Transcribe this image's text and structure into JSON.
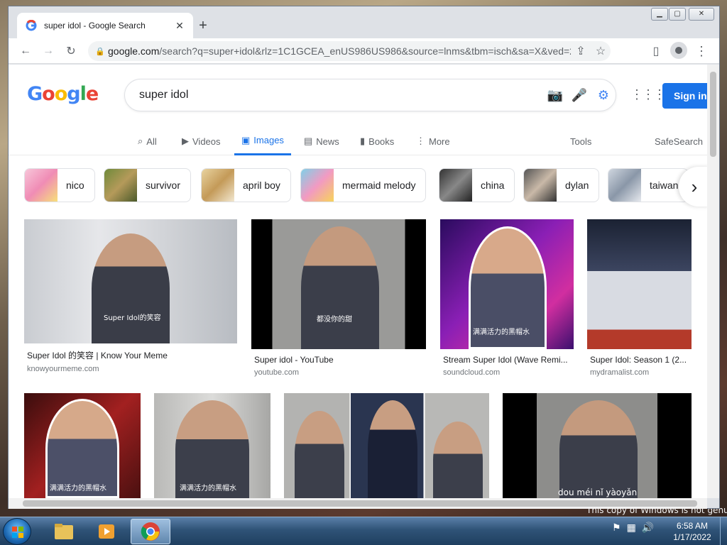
{
  "desktop": {
    "watermark": "This copy of Windows is not genuine"
  },
  "browser": {
    "tab_title": "super idol - Google Search",
    "url_domain": "google.com",
    "url_path": "/search?q=super+idol&rlz=1C1GCEA_enUS986US986&source=lnms&tbm=isch&sa=X&ved=2a..."
  },
  "google": {
    "logo_text": "Google",
    "query": "super idol",
    "signin_label": "Sign in",
    "nav": {
      "all": "All",
      "videos": "Videos",
      "images": "Images",
      "news": "News",
      "books": "Books",
      "more": "More",
      "tools": "Tools",
      "safesearch": "SafeSearch"
    },
    "chips": [
      "nico",
      "survivor",
      "april boy",
      "mermaid melody",
      "china",
      "dylan",
      "taiwan"
    ],
    "results": [
      {
        "title": "Super Idol 的笑容 | Know Your Meme",
        "source": "knowyourmeme.com",
        "caption": "Super Idol的笑容"
      },
      {
        "title": "Super idol - YouTube",
        "source": "youtube.com",
        "caption": "都没你的甜"
      },
      {
        "title": "Stream Super Idol (Wave Remi...",
        "source": "soundcloud.com",
        "caption": "满满活力的黑帽水"
      },
      {
        "title": "Super Idol: Season 1 (2...",
        "source": "mydramalist.com",
        "caption": ""
      }
    ],
    "row2_captions": [
      "满满活力的黑帽水",
      "满满活力的黑帽水",
      "dou méi nǐ yàoyǎn"
    ]
  },
  "taskbar": {
    "time": "6:58 AM",
    "date": "1/17/2022"
  },
  "colors": {
    "google_blue": "#4285f4",
    "google_red": "#ea4335",
    "google_yellow": "#fbbc05",
    "google_green": "#34a853",
    "accent": "#1a73e8"
  }
}
